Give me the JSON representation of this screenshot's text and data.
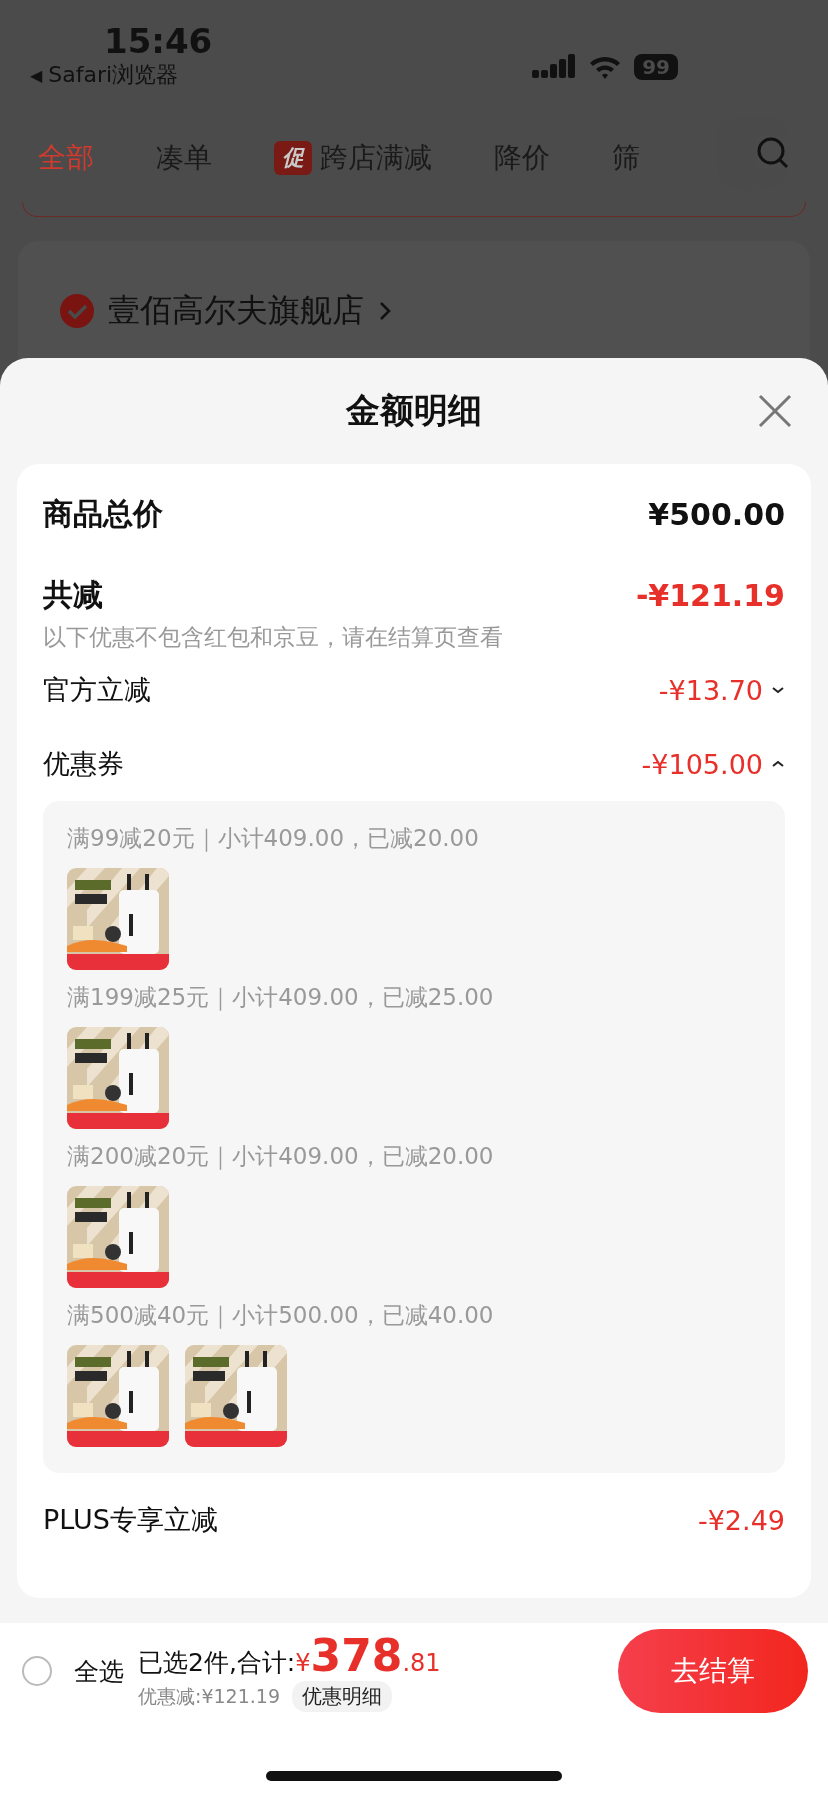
{
  "status_bar": {
    "time": "15:46",
    "back_arrow": "◀",
    "back_label": "Safari浏览器",
    "battery": "99"
  },
  "tabs": [
    {
      "label": "全部",
      "selected": true
    },
    {
      "label": "凑单",
      "selected": false
    },
    {
      "label": "跨店满减",
      "badge": "促",
      "selected": false
    },
    {
      "label": "降价",
      "selected": false
    },
    {
      "label": "筛",
      "selected": false
    }
  ],
  "store": {
    "name": "壹佰高尔夫旗舰店",
    "checked": true
  },
  "sheet": {
    "title": "金额明细",
    "total": {
      "label": "商品总价",
      "value": "¥500.00"
    },
    "discount": {
      "label": "共减",
      "value": "-¥121.19",
      "note": "以下优惠不包含红包和京豆，请在结算页查看"
    },
    "items": [
      {
        "label": "官方立减",
        "value": "-¥13.70",
        "expanded": false
      },
      {
        "label": "优惠券",
        "value": "-¥105.00",
        "expanded": true,
        "groups": [
          {
            "text": "满99减20元｜小计409.00，已减20.00"
          },
          {
            "text": "满199减25元｜小计409.00，已减25.00"
          },
          {
            "text": "满200减20元｜小计409.00，已减20.00"
          },
          {
            "text": "满500减40元｜小计500.00，已减40.00"
          }
        ]
      }
    ],
    "plus": {
      "label": "PLUS专享立减",
      "value": "-¥2.49"
    }
  },
  "bottom_bar": {
    "select_all": {
      "label": "全选",
      "checked": false
    },
    "summary": "已选2件,合计:",
    "currency": "¥",
    "integer": "378",
    "decimal": ".81",
    "saved": "优惠减:¥121.19",
    "detail_link": "优惠明细",
    "checkout": "去结算"
  }
}
